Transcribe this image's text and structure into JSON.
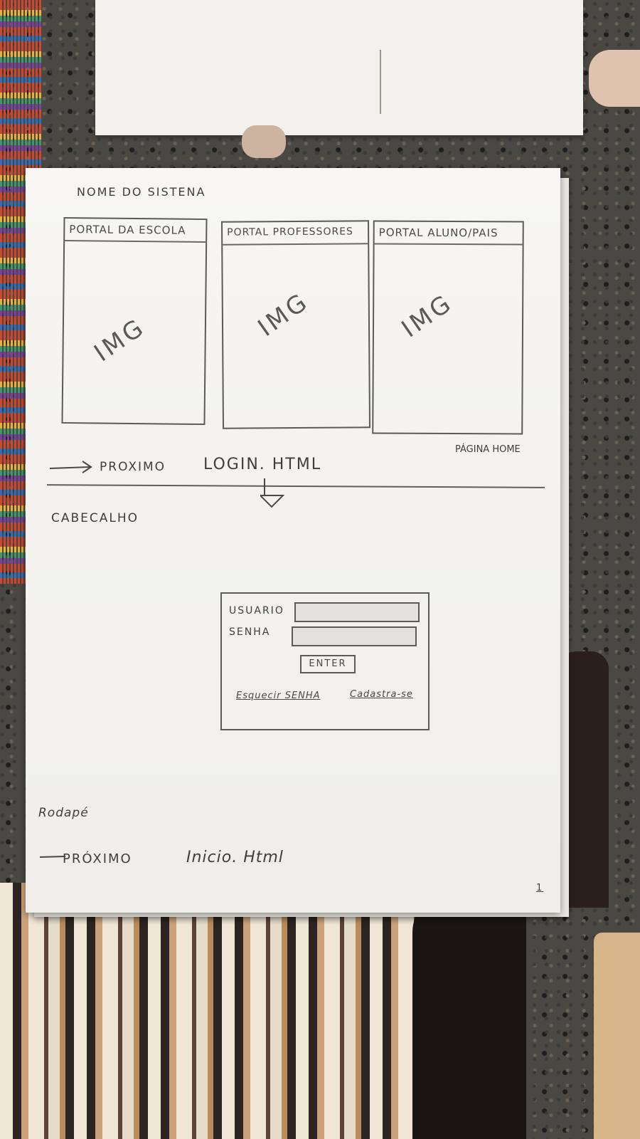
{
  "sketch": {
    "system_name": "NOME DO SISTENA",
    "panels": [
      {
        "title": "PORTAL DA ESCOLA",
        "image_label": "IMG"
      },
      {
        "title": "PORTAL PROFESSORES",
        "image_label": "IMG"
      },
      {
        "title": "PORTAL ALUNO/PAIS",
        "image_label": "IMG"
      }
    ],
    "page_home_note": "PÁGINA HOME",
    "next_label": "PROXIMO",
    "next_target": "LOGIN. HTML",
    "header_label": "CABECALHO",
    "login": {
      "user_label": "USUARIO",
      "password_label": "SENHA",
      "enter_button": "ENTER",
      "forgot_link": "Esquecir SENHA",
      "register_link": "Cadastra-se"
    },
    "footer_label": "Rodapé",
    "footer_next_label": "PRÓXIMO",
    "footer_next_target": "Inicio. Html",
    "page_number": "1"
  }
}
